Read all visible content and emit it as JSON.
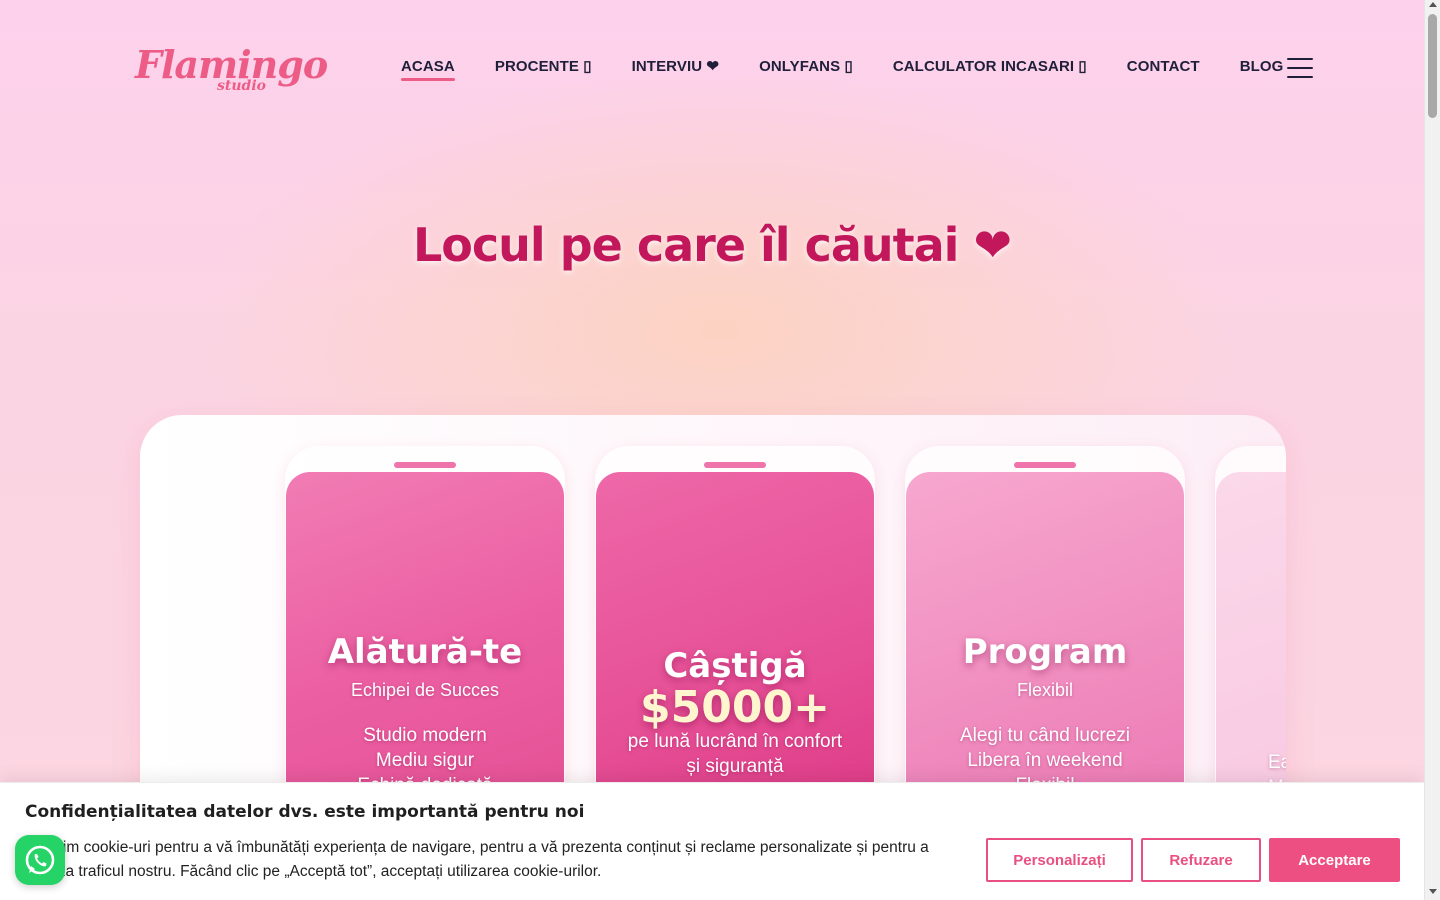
{
  "brand": {
    "name": "Flamingo",
    "tagline": "studio"
  },
  "nav": {
    "items": [
      {
        "label": "ACASA"
      },
      {
        "label": "PROCENTE ▯"
      },
      {
        "label": "INTERVIU ❤"
      },
      {
        "label": "ONLYFANS ▯"
      },
      {
        "label": "CALCULATOR INCASARI ▯"
      },
      {
        "label": "CONTACT"
      },
      {
        "label": "BLOG"
      }
    ],
    "active": "ACASA",
    "menu_icon": "hamburger-icon"
  },
  "hero": {
    "title": "Locul pe care îl căutai ❤"
  },
  "cards": [
    {
      "title": "Alătură-te",
      "subtitle": "Echipei de Succes",
      "lines": [
        "Studio modern",
        "Mediu sigur",
        "Echipă dedicată"
      ]
    },
    {
      "title": "Câștigă",
      "amount": "$5000+",
      "lines": [
        "pe lună lucrând în confort",
        "și siguranță"
      ]
    },
    {
      "title": "Program",
      "subtitle": "Flexibil",
      "lines": [
        "Alegi tu când lucrezi",
        "Libera în weekend",
        "Flexibil"
      ]
    },
    {
      "lines": [
        "Ea",
        "M"
      ]
    }
  ],
  "cookie": {
    "title": "Confidențialitatea datelor dvs. este importantă pentru noi",
    "text_line1": "Folosim cookie-uri pentru a vă îmbunătăți experiența de navigare, pentru a vă prezenta conținut și reclame personalizate și pentru a",
    "text_line2": "analiza traficul nostru. Făcând clic pe „Acceptă tot”, acceptați utilizarea cookie-urilor.",
    "buttons": {
      "customize": "Personalizați",
      "reject": "Refuzare",
      "accept": "Acceptare"
    }
  },
  "colors": {
    "accent": "#ec5c86",
    "title": "#c2185b",
    "nav_text": "#1f1f3a",
    "whatsapp": "#25d366"
  }
}
